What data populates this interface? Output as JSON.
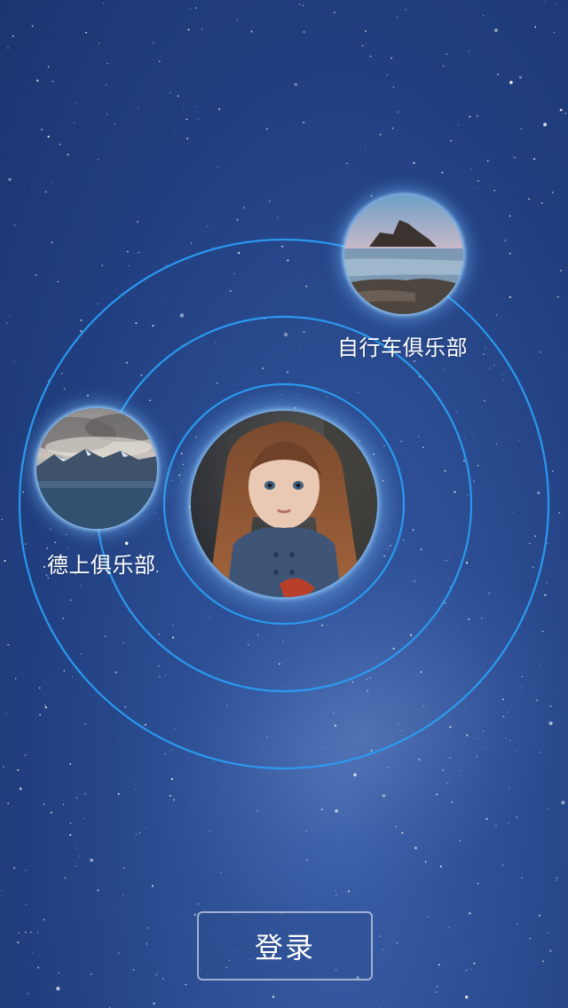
{
  "clubs": [
    {
      "label": "自行车俱乐部",
      "image_icon": "seascape-rocks-icon"
    },
    {
      "label": "德上俱乐部",
      "image_icon": "mountain-cloud-landscape-icon"
    }
  ],
  "center_avatar": {
    "image_icon": "girl-portrait-avatar"
  },
  "login": {
    "label": "登录"
  },
  "colors": {
    "background": "#213f80",
    "orbit": "#2a9df4",
    "glow": "#78beff",
    "button_border": "#c8d2e6"
  }
}
